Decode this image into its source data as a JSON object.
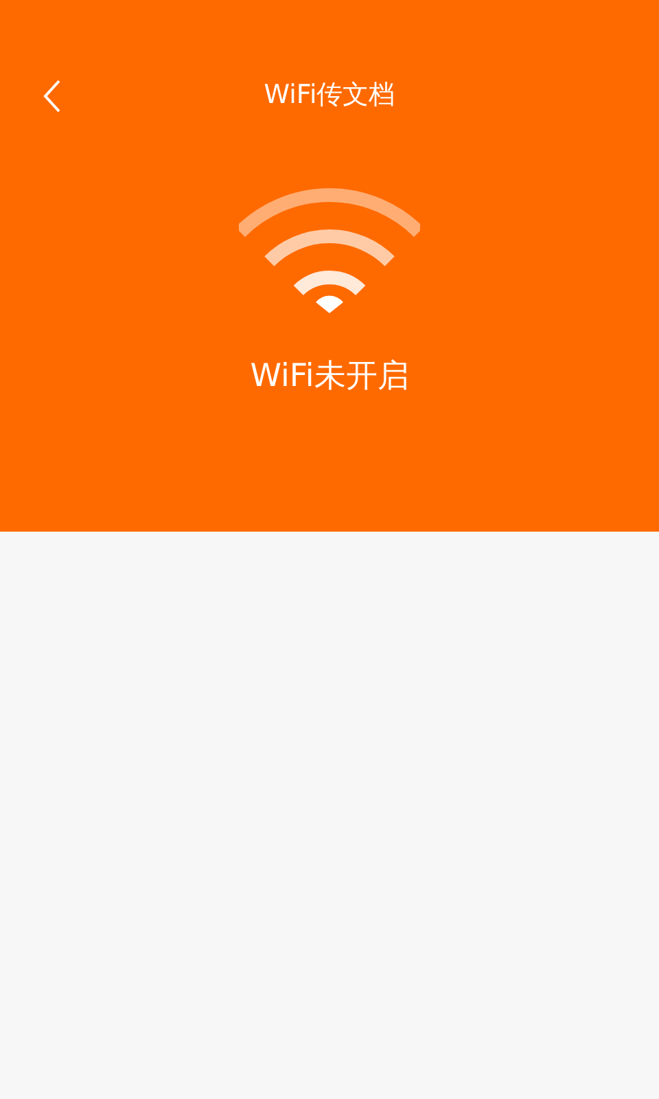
{
  "header": {
    "title": "WiFi传文档"
  },
  "status": {
    "text": "WiFi未开启"
  }
}
